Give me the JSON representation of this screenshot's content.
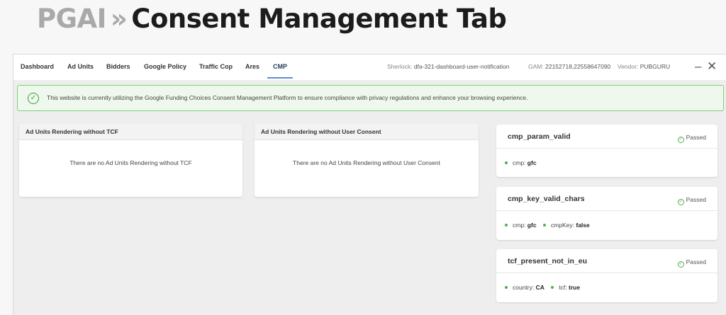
{
  "hero": {
    "prefix": "PGAI",
    "separator": "»",
    "title": "Consent Management Tab"
  },
  "tabs": [
    {
      "label": "Dashboard",
      "active": false
    },
    {
      "label": "Ad Units",
      "active": false
    },
    {
      "label": "Bidders",
      "active": false
    },
    {
      "label": "Google Policy",
      "active": false
    },
    {
      "label": "Traffic Cop",
      "active": false
    },
    {
      "label": "Ares",
      "active": false
    },
    {
      "label": "CMP",
      "active": true
    }
  ],
  "meta": {
    "sherlock_label": "Sherlock:",
    "sherlock_value": "dfa-321-dashboard-user-notification",
    "gam_label": "GAM:",
    "gam_value": "22152718,22558647090",
    "vendor_label": "Vendor:",
    "vendor_value": "PUBGURU"
  },
  "window": {
    "minimize": "–",
    "close": "✕"
  },
  "alert": {
    "icon": "check-circle-icon",
    "text": "This website is currently utilizing the Google Funding Choices Consent Management Platform to ensure compliance with privacy regulations and enhance your browsing experience."
  },
  "cards": [
    {
      "title": "Ad Units Rendering without TCF",
      "empty": "There are no Ad Units Rendering without TCF"
    },
    {
      "title": "Ad Units Rendering without User Consent",
      "empty": "There are no Ad Units Rendering without User Consent"
    }
  ],
  "checks": [
    {
      "name": "cmp_param_valid",
      "status": "Passed",
      "params": [
        {
          "key": "cmp:",
          "value": "gfc"
        }
      ]
    },
    {
      "name": "cmp_key_valid_chars",
      "status": "Passed",
      "params": [
        {
          "key": "cmp:",
          "value": "gfc"
        },
        {
          "key": "cmpKey:",
          "value": "false"
        }
      ]
    },
    {
      "name": "tcf_present_not_in_eu",
      "status": "Passed",
      "params": [
        {
          "key": "country:",
          "value": "CA"
        },
        {
          "key": "tcf:",
          "value": "true"
        }
      ]
    }
  ],
  "colors": {
    "pass_green": "#4caf50",
    "alert_border": "#7fcf7a",
    "active_tab_underline": "#5b8ed6"
  }
}
